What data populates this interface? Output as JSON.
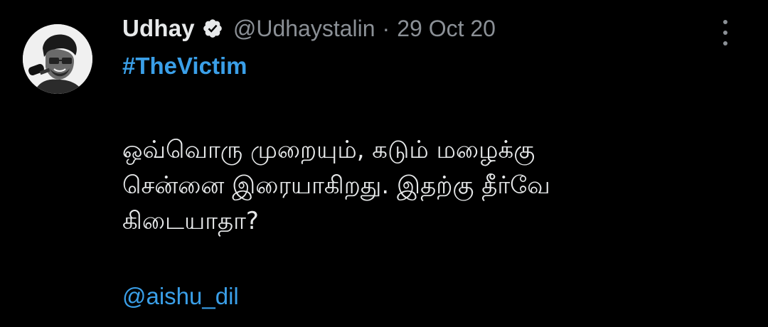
{
  "tweet": {
    "author": {
      "display_name": "Udhay",
      "handle": "@Udhaystalin",
      "verified": true,
      "avatar": "profile-photo"
    },
    "separator": "·",
    "timestamp": "29 Oct 20",
    "hashtag": "#TheVictim",
    "body_lines": [
      "ஒவ்வொரு முறையும், கடும் மழைக்கு",
      "சென்னை இரையாகிறது. இதற்கு தீர்வே",
      "கிடையாதா?"
    ],
    "mention": "@aishu_dil",
    "more_icon": "more-vertical-icon"
  },
  "colors": {
    "background": "#000000",
    "text_primary": "#e7e9ea",
    "text_secondary": "#8b9096",
    "link": "#3a9fe8",
    "verified_badge": "#1d9bf0"
  }
}
